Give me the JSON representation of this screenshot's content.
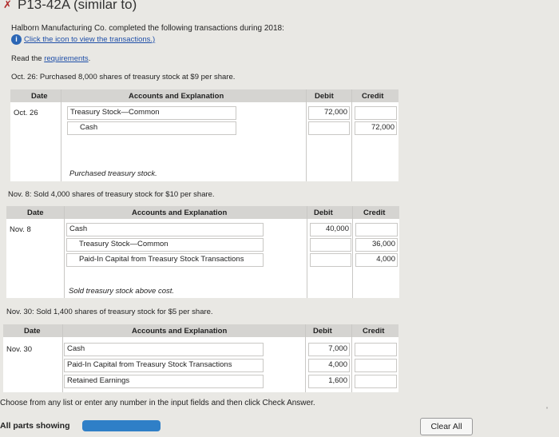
{
  "header": {
    "title": "P13-42A (similar to)",
    "intro": "Halborn Manufacturing Co. completed the following transactions during 2018:",
    "info_link": "Click the icon to view the transactions.)",
    "read_prefix": "Read the ",
    "requirements_link": "requirements",
    "read_suffix": "."
  },
  "columns": {
    "date": "Date",
    "accounts": "Accounts and Explanation",
    "debit": "Debit",
    "credit": "Credit"
  },
  "transactions": [
    {
      "prompt": "Oct. 26: Purchased 8,000 shares of treasury stock at $9 per share.",
      "date": "Oct. 26",
      "rows": [
        {
          "account": "Treasury Stock—Common",
          "debit": "72,000",
          "credit": ""
        },
        {
          "account": "Cash",
          "debit": "",
          "credit": "72,000"
        }
      ],
      "note": "Purchased treasury stock."
    },
    {
      "prompt": "Nov. 8: Sold 4,000 shares of treasury stock for $10 per share.",
      "date": "Nov. 8",
      "rows": [
        {
          "account": "Cash",
          "debit": "40,000",
          "credit": ""
        },
        {
          "account": "Treasury Stock—Common",
          "debit": "",
          "credit": "36,000"
        },
        {
          "account": "Paid-In Capital from Treasury Stock Transactions",
          "debit": "",
          "credit": "4,000"
        }
      ],
      "note": "Sold treasury stock above cost."
    },
    {
      "prompt": "Nov. 30: Sold 1,400 shares of treasury stock for $5 per share.",
      "date": "Nov. 30",
      "rows": [
        {
          "account": "Cash",
          "debit": "7,000",
          "credit": ""
        },
        {
          "account": "Paid-In Capital from Treasury Stock Transactions",
          "debit": "4,000",
          "credit": ""
        },
        {
          "account": "Retained Earnings",
          "debit": "1,600",
          "credit": ""
        }
      ]
    }
  ],
  "footer": {
    "instruction": "Choose from any list or enter any number in the input fields and then click Check Answer.",
    "parts_showing": "All parts showing",
    "clear_all": "Clear All"
  },
  "colors": {
    "progress": "#2f7fc7",
    "link": "#1f4fa8",
    "header_bg": "#d5d4d1"
  }
}
